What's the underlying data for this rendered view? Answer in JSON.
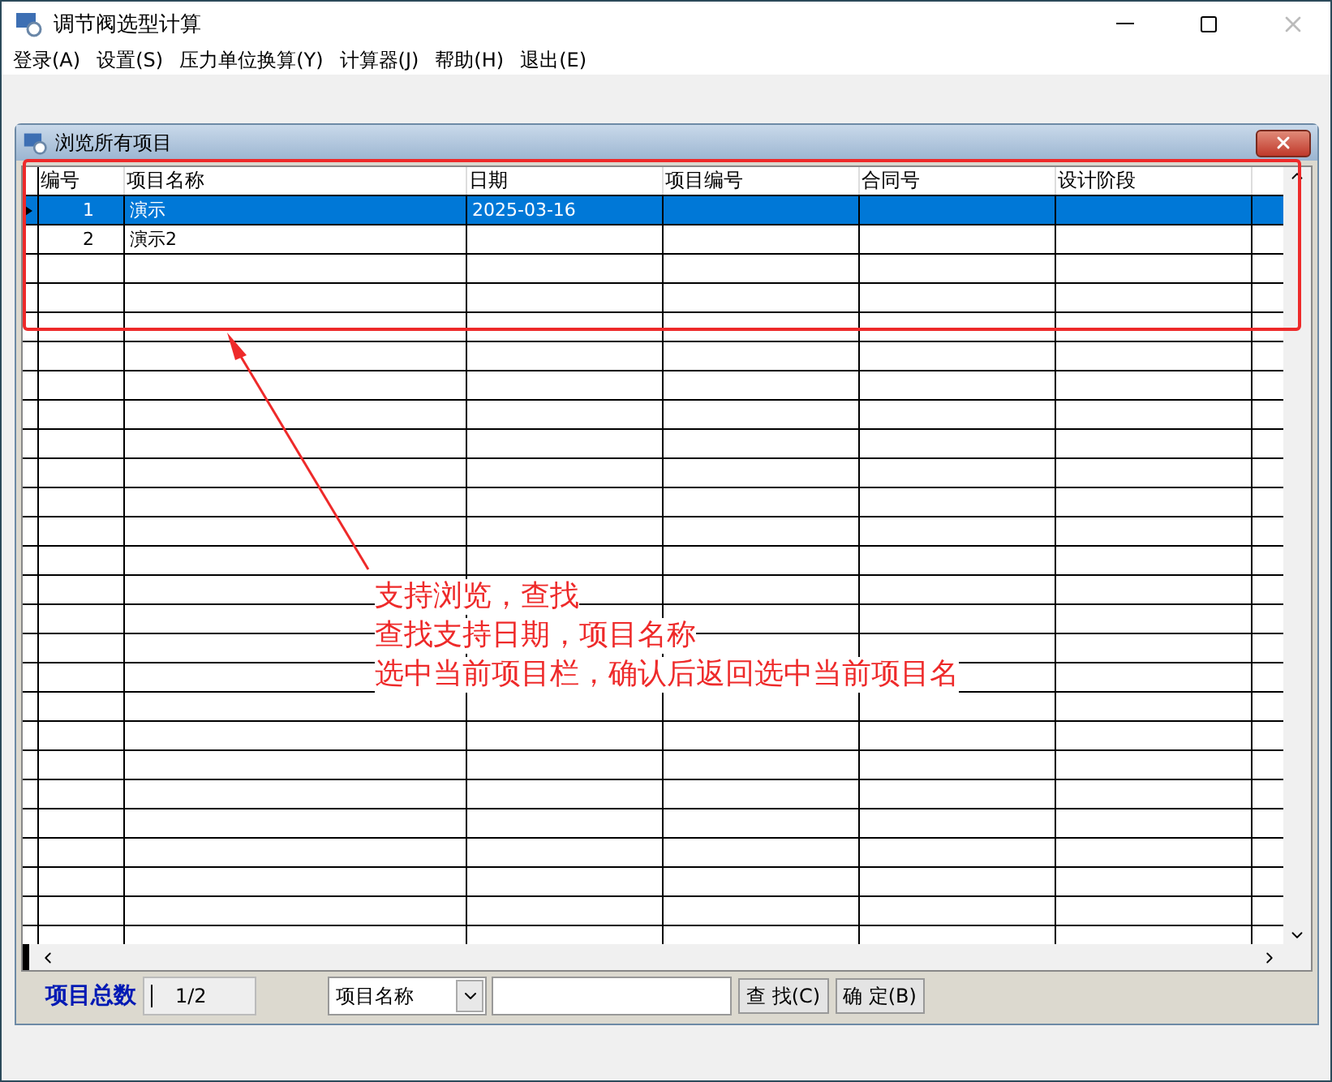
{
  "window": {
    "title": "调节阀选型计算"
  },
  "menu": [
    "登录(A)",
    "设置(S)",
    "压力单位换算(Y)",
    "计算器(J)",
    "帮助(H)",
    "退出(E)"
  ],
  "dialog": {
    "title": "浏览所有项目",
    "table": {
      "columns": [
        "编号",
        "项目名称",
        "日期",
        "项目编号",
        "合同号",
        "设计阶段"
      ],
      "rows": [
        {
          "cells": [
            "1",
            "演示",
            "2025-03-16",
            "",
            "",
            ""
          ],
          "selected": true
        },
        {
          "cells": [
            "2",
            "演示2",
            "",
            "",
            "",
            ""
          ],
          "selected": false
        }
      ]
    },
    "annotation": [
      "支持浏览，查找",
      "查找支持日期，项目名称",
      "选中当前项目栏，确认后返回选中当前项目名"
    ],
    "footer": {
      "label": "项目总数",
      "count": "1/2",
      "search_by": "项目名称",
      "buttons": [
        "查 找(C)",
        "确 定(B)"
      ]
    }
  }
}
